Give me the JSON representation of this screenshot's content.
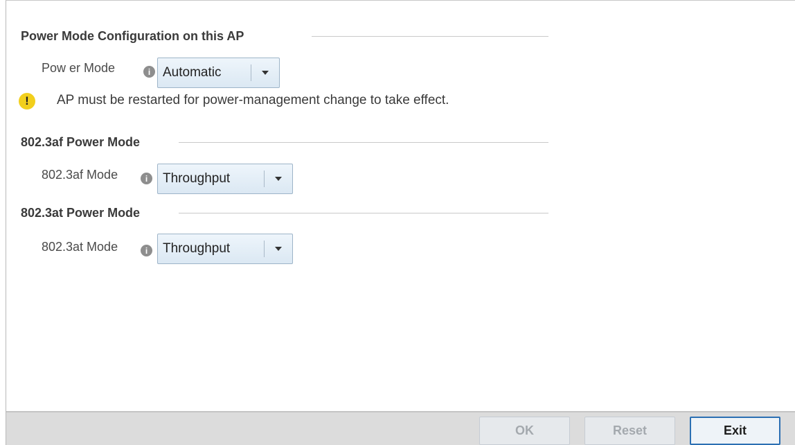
{
  "power_mode_section": {
    "title": "Power Mode Configuration on this AP",
    "label": "Pow er Mode",
    "value": "Automatic",
    "warning": "AP must be restarted for power-management change to take effect."
  },
  "af_section": {
    "title": "802.3af Power Mode",
    "label": "802.3af Mode",
    "value": "Throughput"
  },
  "at_section": {
    "title": "802.3at Power Mode",
    "label": "802.3at Mode",
    "value": "Throughput"
  },
  "icons": {
    "info": "i",
    "warning": "!",
    "dropdown": "chevron-down-icon"
  },
  "colors": {
    "warning": "#f2cf1c",
    "primary_border": "#2b6fb3",
    "select_bg": "#dbe8f3"
  },
  "footer": {
    "ok": "OK",
    "reset": "Reset",
    "exit": "Exit"
  }
}
